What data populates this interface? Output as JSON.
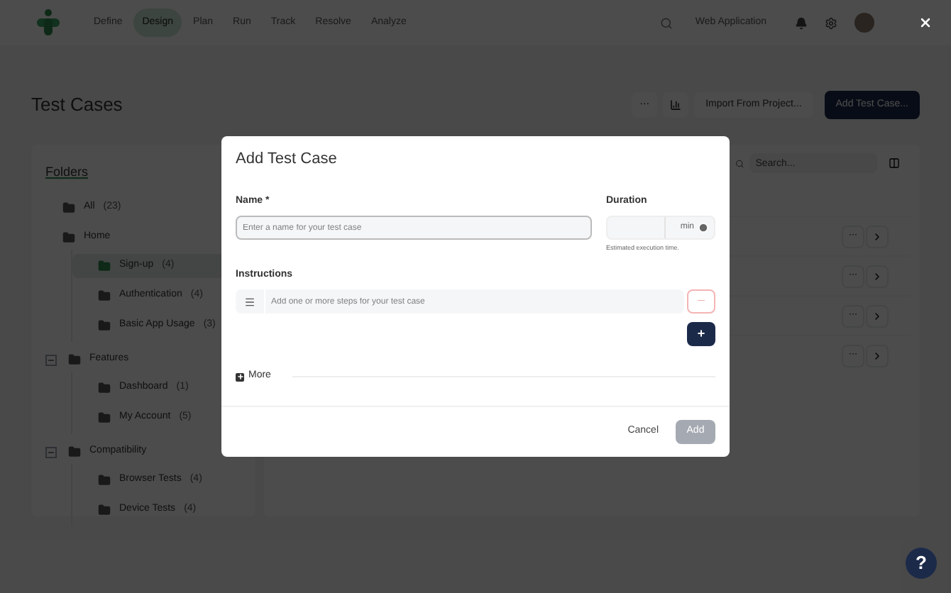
{
  "nav": {
    "items": [
      {
        "label": "Define",
        "selected": false
      },
      {
        "label": "Design",
        "selected": true
      },
      {
        "label": "Plan",
        "selected": false
      },
      {
        "label": "Run",
        "selected": false
      },
      {
        "label": "Track",
        "selected": false
      },
      {
        "label": "Resolve",
        "selected": false
      },
      {
        "label": "Analyze",
        "selected": false
      }
    ],
    "project": "Web Application"
  },
  "page": {
    "title": "Test Cases",
    "more": "···",
    "import_button": "Import From Project...",
    "add_button": "Add Test Case..."
  },
  "folders": {
    "title": "Folders",
    "items": [
      {
        "label": "All",
        "count": "(23)",
        "selected": false
      },
      {
        "label": "Home",
        "selected": false,
        "children": [
          {
            "label": "Sign-up",
            "count": "(4)",
            "selected": true
          },
          {
            "label": "Authentication",
            "count": "(4)",
            "selected": false
          },
          {
            "label": "Basic App Usage",
            "count": "(3)",
            "selected": false
          }
        ]
      },
      {
        "label": "Features",
        "selected": false,
        "expanded": true,
        "children": [
          {
            "label": "Dashboard",
            "count": "(1)",
            "selected": false
          },
          {
            "label": "My Account",
            "count": "(5)",
            "selected": false
          }
        ]
      },
      {
        "label": "Compatibility",
        "selected": false,
        "expanded": true,
        "children": [
          {
            "label": "Browser Tests",
            "count": "(4)",
            "selected": false
          },
          {
            "label": "Device Tests",
            "count": "(4)",
            "selected": false
          }
        ]
      }
    ]
  },
  "list": {
    "search_placeholder": "Search...",
    "row_more": "···"
  },
  "dialog": {
    "title": "Add Test Case",
    "name_label": "Name *",
    "name_placeholder": "Enter a name for your test case",
    "duration_label": "Duration",
    "duration_unit": "min",
    "duration_hint": "Estimated execution time.",
    "instructions_label": "Instructions",
    "step_placeholder": "Add one or more steps for your test case",
    "remove_step": "—",
    "add_step": "+",
    "more": "More",
    "cancel": "Cancel",
    "add": "Add",
    "add_disabled": true
  },
  "help": "?"
}
